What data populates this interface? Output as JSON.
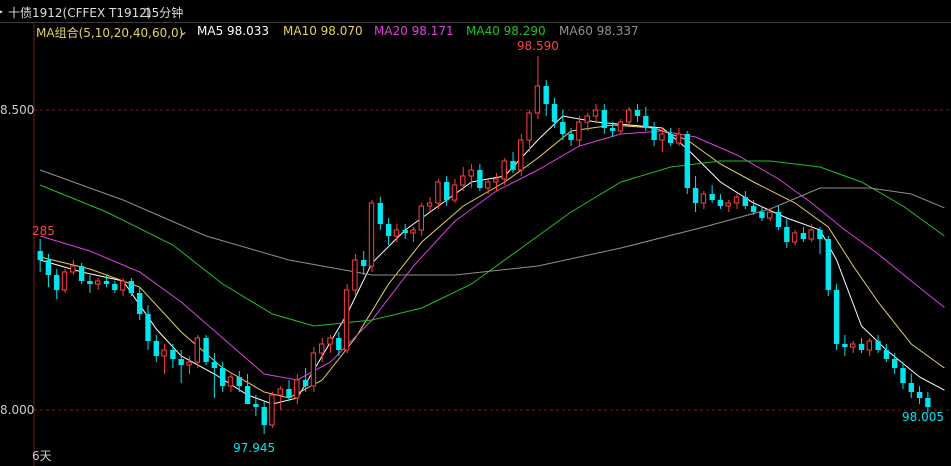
{
  "header": {
    "title": "十债1912(CFFEX T1912)",
    "period": "15分钟",
    "dropdown_icon": "chevron-down-icon"
  },
  "ma_legend": {
    "group_label": "MA组合(5,10,20,40,60,0)",
    "items": [
      {
        "label": "MA5",
        "value": "98.033",
        "color": "#ffffff"
      },
      {
        "label": "MA10",
        "value": "98.070",
        "color": "#e6d35a"
      },
      {
        "label": "MA20",
        "value": "98.171",
        "color": "#e040e0"
      },
      {
        "label": "MA40",
        "value": "98.290",
        "color": "#22c022"
      },
      {
        "label": "MA60",
        "value": "98.337",
        "color": "#909090"
      }
    ]
  },
  "chart_data": {
    "type": "candlestick",
    "y_ticks": [
      {
        "value": 98.5,
        "label": "8.500"
      },
      {
        "value": 98.0,
        "label": "8.000"
      }
    ],
    "ylim": [
      97.94,
      98.61
    ],
    "annotations": {
      "high": "98.590",
      "low": "97.945",
      "last": "98.005",
      "left_partial": "285",
      "period_label": "6天"
    },
    "colors": {
      "up": "#ff4040",
      "down": "#00e5ee",
      "grid": "#7a1a1a"
    },
    "candles": [
      [
        98.265,
        98.285,
        98.23,
        98.25
      ],
      [
        98.25,
        98.26,
        98.205,
        98.225
      ],
      [
        98.225,
        98.235,
        98.185,
        98.2
      ],
      [
        98.2,
        98.235,
        98.195,
        98.23
      ],
      [
        98.23,
        98.25,
        98.225,
        98.24
      ],
      [
        98.24,
        98.245,
        98.21,
        98.215
      ],
      [
        98.215,
        98.225,
        98.195,
        98.21
      ],
      [
        98.21,
        98.22,
        98.2,
        98.215
      ],
      [
        98.215,
        98.225,
        98.205,
        98.21
      ],
      [
        98.21,
        98.215,
        98.195,
        98.2
      ],
      [
        98.2,
        98.22,
        98.19,
        98.215
      ],
      [
        98.215,
        98.22,
        98.19,
        98.195
      ],
      [
        98.195,
        98.205,
        98.15,
        98.16
      ],
      [
        98.16,
        98.175,
        98.1,
        98.115
      ],
      [
        98.115,
        98.125,
        98.08,
        98.09
      ],
      [
        98.09,
        98.11,
        98.06,
        98.1
      ],
      [
        98.1,
        98.11,
        98.07,
        98.085
      ],
      [
        98.085,
        98.1,
        98.045,
        98.075
      ],
      [
        98.075,
        98.09,
        98.06,
        98.08
      ],
      [
        98.08,
        98.125,
        98.07,
        98.12
      ],
      [
        98.12,
        98.125,
        98.075,
        98.08
      ],
      [
        98.08,
        98.095,
        98.02,
        98.07
      ],
      [
        98.07,
        98.08,
        98.03,
        98.04
      ],
      [
        98.04,
        98.06,
        98.03,
        98.055
      ],
      [
        98.055,
        98.065,
        98.03,
        98.04
      ],
      [
        98.04,
        98.06,
        98.02,
        98.01
      ],
      [
        98.01,
        98.025,
        97.99,
        98.005
      ],
      [
        98.005,
        98.015,
        97.96,
        97.975
      ],
      [
        97.975,
        98.03,
        97.97,
        98.025
      ],
      [
        98.025,
        98.04,
        98.0,
        98.035
      ],
      [
        98.035,
        98.05,
        98.015,
        98.02
      ],
      [
        98.02,
        98.06,
        98.01,
        98.05
      ],
      [
        98.05,
        98.07,
        98.03,
        98.04
      ],
      [
        98.04,
        98.105,
        98.03,
        98.095
      ],
      [
        98.095,
        98.12,
        98.08,
        98.11
      ],
      [
        98.11,
        98.125,
        98.095,
        98.12
      ],
      [
        98.12,
        98.13,
        98.09,
        98.1
      ],
      [
        98.1,
        98.21,
        98.095,
        98.2
      ],
      [
        98.2,
        98.26,
        98.19,
        98.25
      ],
      [
        98.25,
        98.265,
        98.225,
        98.24
      ],
      [
        98.24,
        98.35,
        98.23,
        98.345
      ],
      [
        98.345,
        98.355,
        98.3,
        98.31
      ],
      [
        98.31,
        98.32,
        98.275,
        98.29
      ],
      [
        98.29,
        98.31,
        98.28,
        98.3
      ],
      [
        98.3,
        98.31,
        98.285,
        98.295
      ],
      [
        98.295,
        98.305,
        98.28,
        98.3
      ],
      [
        98.3,
        98.345,
        98.29,
        98.34
      ],
      [
        98.34,
        98.355,
        98.33,
        98.345
      ],
      [
        98.345,
        98.385,
        98.335,
        98.38
      ],
      [
        98.38,
        98.39,
        98.34,
        98.35
      ],
      [
        98.35,
        98.385,
        98.345,
        98.375
      ],
      [
        98.375,
        98.405,
        98.365,
        98.39
      ],
      [
        98.39,
        98.41,
        98.37,
        98.4
      ],
      [
        98.4,
        98.41,
        98.365,
        98.37
      ],
      [
        98.37,
        98.385,
        98.36,
        98.38
      ],
      [
        98.38,
        98.395,
        98.365,
        98.385
      ],
      [
        98.385,
        98.42,
        98.375,
        98.415
      ],
      [
        98.415,
        98.43,
        98.395,
        98.4
      ],
      [
        98.4,
        98.46,
        98.39,
        98.45
      ],
      [
        98.45,
        98.5,
        98.43,
        98.495
      ],
      [
        98.495,
        98.59,
        98.485,
        98.54
      ],
      [
        98.54,
        98.55,
        98.49,
        98.51
      ],
      [
        98.51,
        98.52,
        98.47,
        98.48
      ],
      [
        98.48,
        98.5,
        98.45,
        98.46
      ],
      [
        98.46,
        98.47,
        98.44,
        98.45
      ],
      [
        98.45,
        98.49,
        98.44,
        98.48
      ],
      [
        98.48,
        98.495,
        98.465,
        98.49
      ],
      [
        98.49,
        98.51,
        98.48,
        98.5
      ],
      [
        98.5,
        98.51,
        98.46,
        98.47
      ],
      [
        98.47,
        98.48,
        98.455,
        98.465
      ],
      [
        98.465,
        98.485,
        98.46,
        98.48
      ],
      [
        98.48,
        98.505,
        98.475,
        98.5
      ],
      [
        98.5,
        98.51,
        98.48,
        98.49
      ],
      [
        98.49,
        98.505,
        98.465,
        98.47
      ],
      [
        98.47,
        98.48,
        98.44,
        98.45
      ],
      [
        98.45,
        98.47,
        98.43,
        98.46
      ],
      [
        98.46,
        98.47,
        98.44,
        98.445
      ],
      [
        98.445,
        98.47,
        98.44,
        98.46
      ],
      [
        98.46,
        98.465,
        98.36,
        98.37
      ],
      [
        98.37,
        98.39,
        98.33,
        98.345
      ],
      [
        98.345,
        98.365,
        98.335,
        98.36
      ],
      [
        98.36,
        98.375,
        98.345,
        98.35
      ],
      [
        98.35,
        98.36,
        98.335,
        98.34
      ],
      [
        98.34,
        98.35,
        98.33,
        98.345
      ],
      [
        98.345,
        98.36,
        98.335,
        98.355
      ],
      [
        98.355,
        98.365,
        98.335,
        98.34
      ],
      [
        98.34,
        98.35,
        98.325,
        98.33
      ],
      [
        98.33,
        98.34,
        98.315,
        98.32
      ],
      [
        98.32,
        98.335,
        98.315,
        98.33
      ],
      [
        98.33,
        98.34,
        98.3,
        98.305
      ],
      [
        98.305,
        98.32,
        98.27,
        98.28
      ],
      [
        98.28,
        98.3,
        98.275,
        98.295
      ],
      [
        98.295,
        98.305,
        98.28,
        98.285
      ],
      [
        98.285,
        98.31,
        98.28,
        98.3
      ],
      [
        98.3,
        98.305,
        98.26,
        98.285
      ],
      [
        98.285,
        98.29,
        98.19,
        98.2
      ],
      [
        98.2,
        98.21,
        98.1,
        98.11
      ],
      [
        98.11,
        98.125,
        98.09,
        98.105
      ],
      [
        98.105,
        98.115,
        98.095,
        98.11
      ],
      [
        98.11,
        98.12,
        98.095,
        98.1
      ],
      [
        98.1,
        98.12,
        98.09,
        98.115
      ],
      [
        98.115,
        98.125,
        98.095,
        98.1
      ],
      [
        98.1,
        98.11,
        98.08,
        98.085
      ],
      [
        98.085,
        98.095,
        98.06,
        98.07
      ],
      [
        98.07,
        98.08,
        98.035,
        98.045
      ],
      [
        98.045,
        98.06,
        98.02,
        98.03
      ],
      [
        98.03,
        98.04,
        98.01,
        98.02
      ],
      [
        98.02,
        98.03,
        97.995,
        98.005
      ]
    ],
    "ma_series": [
      {
        "name": "MA5",
        "color": "#ffffff",
        "points": [
          [
            0,
            98.25
          ],
          [
            5,
            98.23
          ],
          [
            10,
            98.215
          ],
          [
            14,
            98.135
          ],
          [
            17,
            98.09
          ],
          [
            21,
            98.06
          ],
          [
            25,
            98.025
          ],
          [
            28,
            98.01
          ],
          [
            31,
            98.02
          ],
          [
            34,
            98.09
          ],
          [
            37,
            98.16
          ],
          [
            40,
            98.245
          ],
          [
            44,
            98.3
          ],
          [
            48,
            98.34
          ],
          [
            52,
            98.38
          ],
          [
            56,
            98.39
          ],
          [
            60,
            98.45
          ],
          [
            63,
            98.49
          ],
          [
            67,
            98.48
          ],
          [
            71,
            98.475
          ],
          [
            75,
            98.47
          ],
          [
            78,
            98.435
          ],
          [
            82,
            98.38
          ],
          [
            86,
            98.345
          ],
          [
            90,
            98.32
          ],
          [
            94,
            98.3
          ],
          [
            96,
            98.25
          ],
          [
            99,
            98.14
          ],
          [
            102,
            98.1
          ],
          [
            106,
            98.055
          ],
          [
            109,
            98.033
          ]
        ]
      },
      {
        "name": "MA10",
        "color": "#e6d35a",
        "points": [
          [
            0,
            98.255
          ],
          [
            6,
            98.235
          ],
          [
            12,
            98.205
          ],
          [
            17,
            98.13
          ],
          [
            22,
            98.07
          ],
          [
            27,
            98.03
          ],
          [
            30,
            98.02
          ],
          [
            34,
            98.05
          ],
          [
            38,
            98.12
          ],
          [
            42,
            98.21
          ],
          [
            46,
            98.28
          ],
          [
            51,
            98.34
          ],
          [
            56,
            98.38
          ],
          [
            60,
            98.42
          ],
          [
            64,
            98.465
          ],
          [
            69,
            98.475
          ],
          [
            74,
            98.47
          ],
          [
            78,
            98.45
          ],
          [
            82,
            98.41
          ],
          [
            86,
            98.38
          ],
          [
            91,
            98.345
          ],
          [
            95,
            98.305
          ],
          [
            98,
            98.24
          ],
          [
            101,
            98.18
          ],
          [
            105,
            98.11
          ],
          [
            109,
            98.07
          ]
        ]
      },
      {
        "name": "MA20",
        "color": "#e040e0",
        "points": [
          [
            0,
            98.29
          ],
          [
            6,
            98.265
          ],
          [
            12,
            98.23
          ],
          [
            17,
            98.18
          ],
          [
            22,
            98.12
          ],
          [
            27,
            98.06
          ],
          [
            31,
            98.05
          ],
          [
            35,
            98.08
          ],
          [
            40,
            98.15
          ],
          [
            45,
            98.24
          ],
          [
            50,
            98.315
          ],
          [
            55,
            98.365
          ],
          [
            60,
            98.4
          ],
          [
            65,
            98.44
          ],
          [
            70,
            98.46
          ],
          [
            75,
            98.465
          ],
          [
            79,
            98.455
          ],
          [
            84,
            98.425
          ],
          [
            89,
            98.385
          ],
          [
            93,
            98.345
          ],
          [
            97,
            98.3
          ],
          [
            101,
            98.26
          ],
          [
            105,
            98.215
          ],
          [
            109,
            98.171
          ]
        ]
      },
      {
        "name": "MA40",
        "color": "#22c022",
        "points": [
          [
            0,
            98.375
          ],
          [
            8,
            98.33
          ],
          [
            16,
            98.275
          ],
          [
            22,
            98.21
          ],
          [
            28,
            98.16
          ],
          [
            33,
            98.14
          ],
          [
            40,
            98.15
          ],
          [
            46,
            98.17
          ],
          [
            52,
            98.21
          ],
          [
            58,
            98.27
          ],
          [
            64,
            98.33
          ],
          [
            70,
            98.38
          ],
          [
            76,
            98.405
          ],
          [
            82,
            98.415
          ],
          [
            88,
            98.415
          ],
          [
            94,
            98.405
          ],
          [
            99,
            98.38
          ],
          [
            104,
            98.34
          ],
          [
            109,
            98.29
          ]
        ]
      },
      {
        "name": "MA60",
        "color": "#909090",
        "points": [
          [
            0,
            98.4
          ],
          [
            10,
            98.35
          ],
          [
            20,
            98.29
          ],
          [
            30,
            98.25
          ],
          [
            40,
            98.225
          ],
          [
            50,
            98.225
          ],
          [
            60,
            98.24
          ],
          [
            70,
            98.27
          ],
          [
            80,
            98.305
          ],
          [
            88,
            98.335
          ],
          [
            94,
            98.37
          ],
          [
            100,
            98.37
          ],
          [
            105,
            98.36
          ],
          [
            109,
            98.337
          ]
        ]
      }
    ]
  }
}
